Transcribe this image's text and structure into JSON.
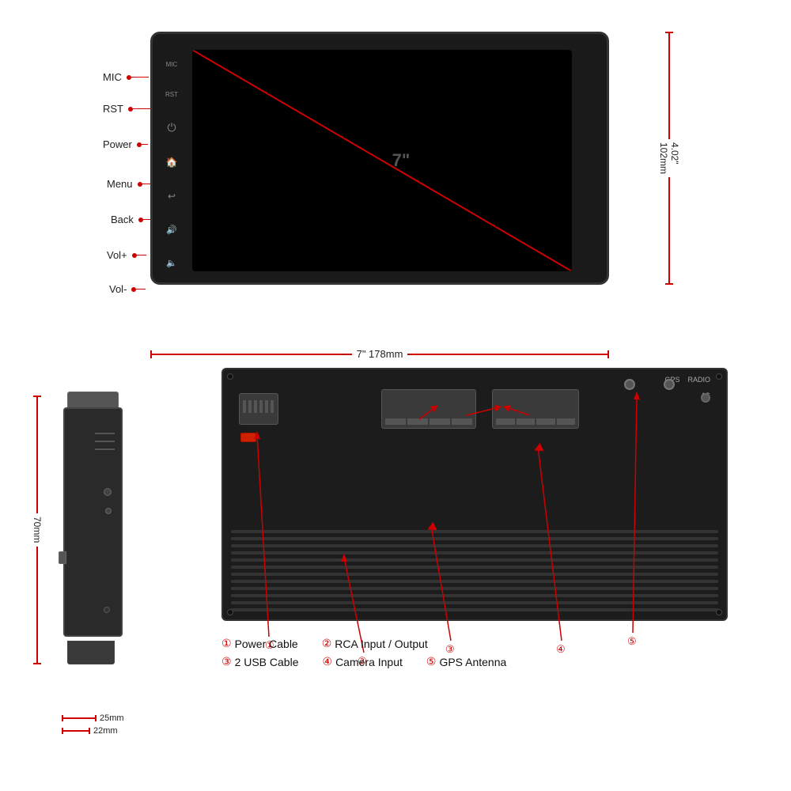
{
  "page": {
    "background": "#ffffff"
  },
  "front_view": {
    "screen_size": "7\"",
    "width_label": "7\"   178mm",
    "height_label_imperial": "4.02\"",
    "height_label_metric": "102mm",
    "buttons": [
      {
        "name": "MIC",
        "icon": "MIC"
      },
      {
        "name": "RST",
        "icon": "RST"
      },
      {
        "name": "Power",
        "icon": "⏻"
      },
      {
        "name": "Menu",
        "icon": "🔔"
      },
      {
        "name": "Back",
        "icon": "↩"
      },
      {
        "name": "Vol+",
        "icon": "🔊+"
      },
      {
        "name": "Vol-",
        "icon": "🔊-"
      }
    ]
  },
  "side_view": {
    "depth_label": "70mm",
    "bottom_dim1": "25mm",
    "bottom_dim2": "22mm"
  },
  "back_view": {
    "labels": [
      {
        "num": "①",
        "name": "GPS",
        "pos": "top-right"
      },
      {
        "num": "②",
        "name": "RADIO",
        "pos": "top-right"
      },
      {
        "num": "③",
        "name": "4G",
        "pos": "top-right"
      }
    ]
  },
  "legend": {
    "items": [
      {
        "num": "①",
        "label": "Power Cable"
      },
      {
        "num": "②",
        "label": "RCA Input / Output"
      },
      {
        "num": "③",
        "label": "2 USB Cable"
      },
      {
        "num": "④",
        "label": "Camera Input"
      },
      {
        "num": "⑤",
        "label": "GPS Antenna"
      }
    ]
  }
}
